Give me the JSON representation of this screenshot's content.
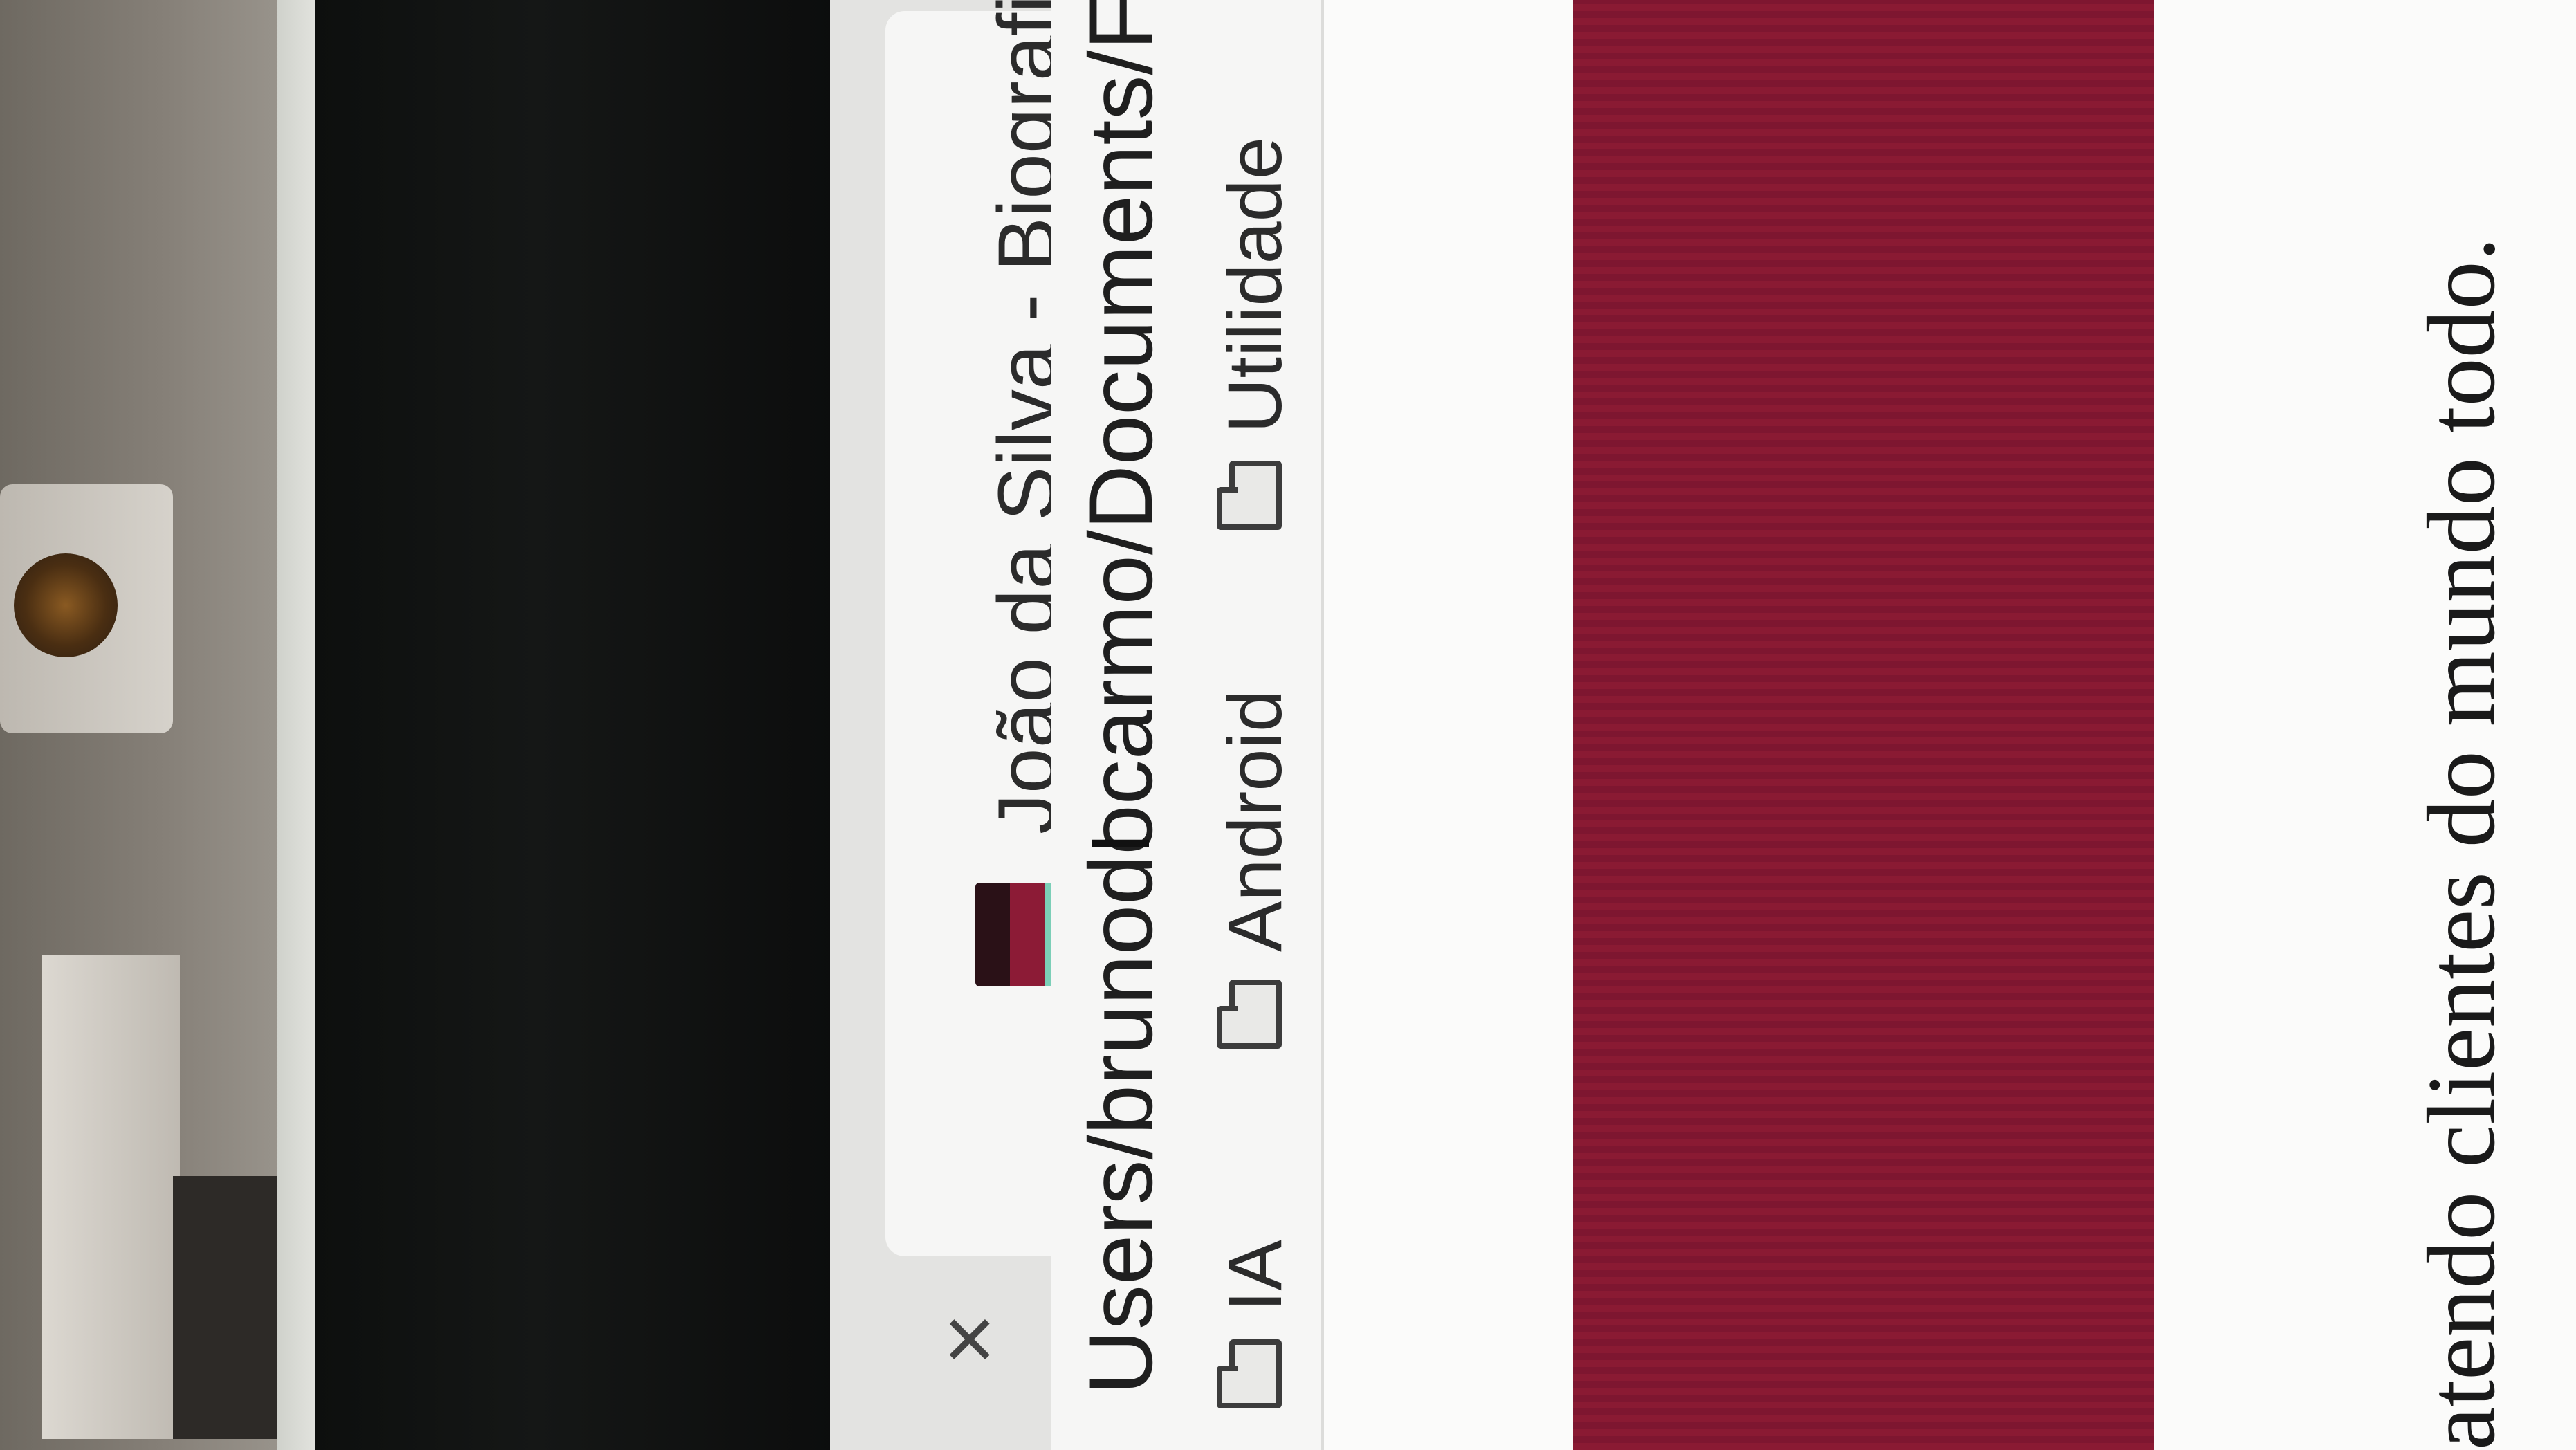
{
  "browser": {
    "tab": {
      "title": "João da Silva - Biografia",
      "close_glyph": "×",
      "favicon_colors": [
        "#2a1117",
        "#8c1b36",
        "#7ccfb8"
      ]
    },
    "address_bar": {
      "url_text": "Users/brunodocarmo/Documents/F"
    },
    "bookmarks": [
      {
        "label": "IA",
        "icon": "folder-icon"
      },
      {
        "label": "Android",
        "icon": "folder-icon"
      },
      {
        "label": "Utilidade",
        "icon": "folder-icon"
      }
    ]
  },
  "page": {
    "hero_color": "#8a1a33",
    "body_text": "atendo clientes do mundo todo."
  }
}
